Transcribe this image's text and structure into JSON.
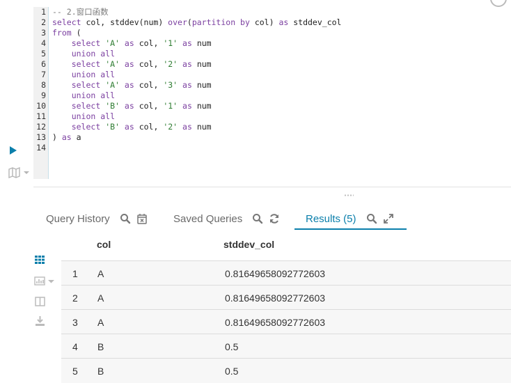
{
  "editor": {
    "line_numbers": [
      "1",
      "2",
      "3",
      "4",
      "5",
      "6",
      "7",
      "8",
      "9",
      "10",
      "11",
      "12",
      "13",
      "14"
    ],
    "lines": [
      [
        {
          "t": "cmt",
          "v": "-- 2.窗口函数"
        }
      ],
      [
        {
          "t": "kw",
          "v": "select"
        },
        {
          "t": "fn",
          "v": " col, stddev(num) "
        },
        {
          "t": "kw",
          "v": "over"
        },
        {
          "t": "fn",
          "v": "("
        },
        {
          "t": "kw",
          "v": "partition by"
        },
        {
          "t": "fn",
          "v": " col) "
        },
        {
          "t": "kw",
          "v": "as"
        },
        {
          "t": "fn",
          "v": " stddev_col"
        }
      ],
      [
        {
          "t": "kw",
          "v": "from"
        },
        {
          "t": "fn",
          "v": " ("
        }
      ],
      [
        {
          "t": "fn",
          "v": "    "
        },
        {
          "t": "kw",
          "v": "select"
        },
        {
          "t": "fn",
          "v": " "
        },
        {
          "t": "str",
          "v": "'A'"
        },
        {
          "t": "fn",
          "v": " "
        },
        {
          "t": "kw",
          "v": "as"
        },
        {
          "t": "fn",
          "v": " col, "
        },
        {
          "t": "str",
          "v": "'1'"
        },
        {
          "t": "fn",
          "v": " "
        },
        {
          "t": "kw",
          "v": "as"
        },
        {
          "t": "fn",
          "v": " num"
        }
      ],
      [
        {
          "t": "fn",
          "v": "    "
        },
        {
          "t": "kw",
          "v": "union all"
        }
      ],
      [
        {
          "t": "fn",
          "v": "    "
        },
        {
          "t": "kw",
          "v": "select"
        },
        {
          "t": "fn",
          "v": " "
        },
        {
          "t": "str",
          "v": "'A'"
        },
        {
          "t": "fn",
          "v": " "
        },
        {
          "t": "kw",
          "v": "as"
        },
        {
          "t": "fn",
          "v": " col, "
        },
        {
          "t": "str",
          "v": "'2'"
        },
        {
          "t": "fn",
          "v": " "
        },
        {
          "t": "kw",
          "v": "as"
        },
        {
          "t": "fn",
          "v": " num"
        }
      ],
      [
        {
          "t": "fn",
          "v": "    "
        },
        {
          "t": "kw",
          "v": "union all"
        }
      ],
      [
        {
          "t": "fn",
          "v": "    "
        },
        {
          "t": "kw",
          "v": "select"
        },
        {
          "t": "fn",
          "v": " "
        },
        {
          "t": "str",
          "v": "'A'"
        },
        {
          "t": "fn",
          "v": " "
        },
        {
          "t": "kw",
          "v": "as"
        },
        {
          "t": "fn",
          "v": " col, "
        },
        {
          "t": "str",
          "v": "'3'"
        },
        {
          "t": "fn",
          "v": " "
        },
        {
          "t": "kw",
          "v": "as"
        },
        {
          "t": "fn",
          "v": " num"
        }
      ],
      [
        {
          "t": "fn",
          "v": "    "
        },
        {
          "t": "kw",
          "v": "union all"
        }
      ],
      [
        {
          "t": "fn",
          "v": "    "
        },
        {
          "t": "kw",
          "v": "select"
        },
        {
          "t": "fn",
          "v": " "
        },
        {
          "t": "str",
          "v": "'B'"
        },
        {
          "t": "fn",
          "v": " "
        },
        {
          "t": "kw",
          "v": "as"
        },
        {
          "t": "fn",
          "v": " col, "
        },
        {
          "t": "str",
          "v": "'1'"
        },
        {
          "t": "fn",
          "v": " "
        },
        {
          "t": "kw",
          "v": "as"
        },
        {
          "t": "fn",
          "v": " num"
        }
      ],
      [
        {
          "t": "fn",
          "v": "    "
        },
        {
          "t": "kw",
          "v": "union all"
        }
      ],
      [
        {
          "t": "fn",
          "v": "    "
        },
        {
          "t": "kw",
          "v": "select"
        },
        {
          "t": "fn",
          "v": " "
        },
        {
          "t": "str",
          "v": "'B'"
        },
        {
          "t": "fn",
          "v": " "
        },
        {
          "t": "kw",
          "v": "as"
        },
        {
          "t": "fn",
          "v": " col, "
        },
        {
          "t": "str",
          "v": "'2'"
        },
        {
          "t": "fn",
          "v": " "
        },
        {
          "t": "kw",
          "v": "as"
        },
        {
          "t": "fn",
          "v": " num"
        }
      ],
      [
        {
          "t": "fn",
          "v": ") "
        },
        {
          "t": "kw",
          "v": "as"
        },
        {
          "t": "fn",
          "v": " a"
        }
      ],
      []
    ]
  },
  "tabs": {
    "query_history": "Query History",
    "saved_queries": "Saved Queries",
    "results": "Results (5)"
  },
  "results": {
    "columns": [
      "col",
      "stddev_col"
    ],
    "rows": [
      {
        "num": "1",
        "col": "A",
        "stddev_col": "0.81649658092772603"
      },
      {
        "num": "2",
        "col": "A",
        "stddev_col": "0.81649658092772603"
      },
      {
        "num": "3",
        "col": "A",
        "stddev_col": "0.81649658092772603"
      },
      {
        "num": "4",
        "col": "B",
        "stddev_col": "0.5"
      },
      {
        "num": "5",
        "col": "B",
        "stddev_col": "0.5"
      }
    ]
  },
  "icons": {
    "run": "play-icon",
    "snippet": "map-icon",
    "search": "search-icon",
    "clear_history": "calendar-x-icon",
    "refresh": "refresh-icon",
    "expand": "expand-icon",
    "grid": "grid-icon",
    "chart": "bar-chart-icon",
    "columns": "columns-icon",
    "download": "download-icon"
  },
  "colors": {
    "accent": "#0b7fab",
    "keyword": "#7b3fa0",
    "string": "#2f7d32"
  }
}
